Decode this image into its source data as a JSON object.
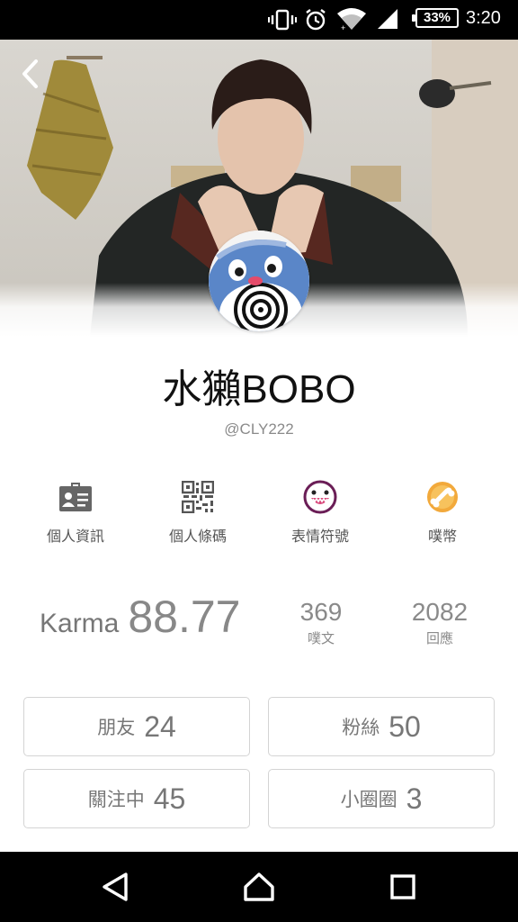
{
  "status_bar": {
    "battery_percent": "33%",
    "time": "3:20",
    "icons": [
      "vibrate-icon",
      "alarm-icon",
      "wifi-icon",
      "signal-icon",
      "battery-icon"
    ]
  },
  "profile": {
    "display_name": "水獺BOBO",
    "handle": "@CLY222"
  },
  "actions": [
    {
      "label": "個人資訊",
      "icon": "id-card-icon"
    },
    {
      "label": "個人條碼",
      "icon": "qr-code-icon"
    },
    {
      "label": "表情符號",
      "icon": "emoticon-icon"
    },
    {
      "label": "噗幣",
      "icon": "coin-icon"
    }
  ],
  "stats": {
    "karma_label": "Karma",
    "karma_value": "88.77",
    "posts_value": "369",
    "posts_label": "噗文",
    "replies_value": "2082",
    "replies_label": "回應"
  },
  "counts": {
    "friends": {
      "label": "朋友",
      "value": "24"
    },
    "fans": {
      "label": "粉絲",
      "value": "50"
    },
    "following": {
      "label": "關注中",
      "value": "45"
    },
    "cliques": {
      "label": "小圈圈",
      "value": "3"
    }
  },
  "colors": {
    "status_bar_bg": "#000000",
    "coin_gold": "#f2a93b",
    "text_dark": "#111111",
    "text_muted": "#8a8a8a",
    "border": "#d4d4d4"
  }
}
